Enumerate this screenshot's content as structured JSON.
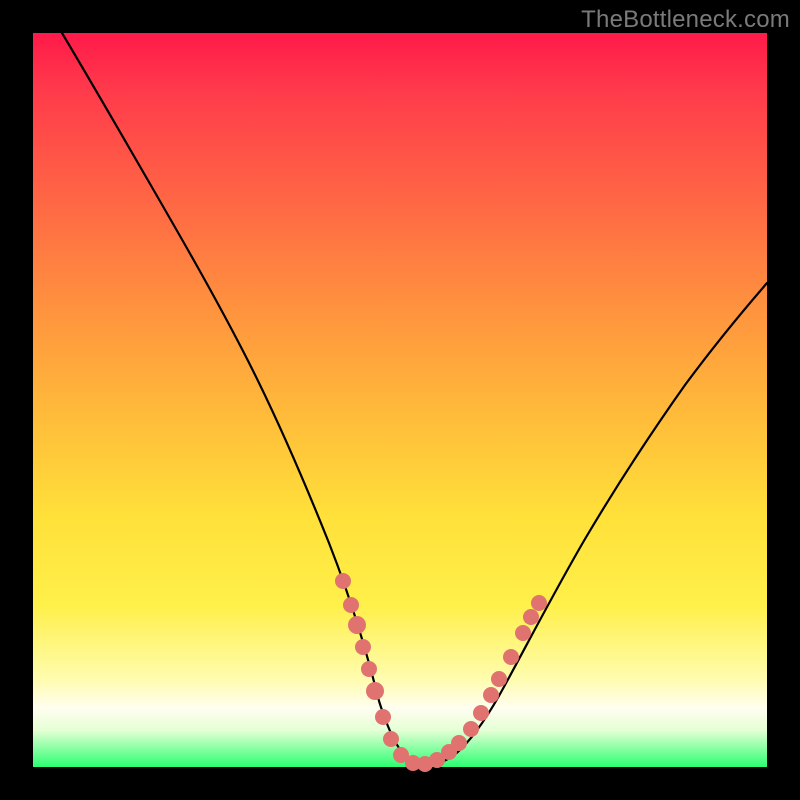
{
  "watermark": "TheBottleneck.com",
  "colors": {
    "frame_bg": "#000000",
    "curve_stroke": "#000000",
    "dot_fill": "#e0736f",
    "gradient_stops": [
      "#ff1a4a",
      "#ff3b4b",
      "#ff6a44",
      "#ff943e",
      "#ffbb3a",
      "#ffe13a",
      "#fff04a",
      "#fffcae",
      "#fffef0",
      "#e5ffd4",
      "#2bff71"
    ]
  },
  "chart_data": {
    "type": "line",
    "title": "",
    "xlabel": "",
    "ylabel": "",
    "x_range": [
      0,
      100
    ],
    "y_range": [
      0,
      100
    ],
    "series": [
      {
        "name": "bottleneck-curve",
        "x": [
          4,
          8,
          12,
          16,
          20,
          24,
          28,
          32,
          36,
          40,
          44,
          46,
          48,
          50,
          52,
          54,
          56,
          60,
          64,
          68,
          72,
          76,
          80,
          84,
          88,
          92,
          96,
          100
        ],
        "y": [
          100,
          93,
          86,
          79,
          72,
          64,
          56,
          47,
          38,
          28,
          17,
          11,
          6,
          2,
          0,
          0,
          1,
          3,
          8,
          14,
          21,
          29,
          37,
          44,
          51,
          57,
          62,
          66
        ]
      },
      {
        "name": "marker-dots",
        "x": [
          42,
          43,
          44,
          45,
          46,
          47,
          49,
          50,
          51,
          52,
          53,
          54,
          55,
          57,
          59,
          60,
          61,
          62,
          63,
          64
        ],
        "y": [
          22,
          18,
          16,
          13,
          11,
          8,
          2,
          1,
          0,
          0,
          0,
          0,
          1,
          2,
          4,
          6,
          8,
          10,
          12,
          14
        ]
      }
    ],
    "note": "Chart has no axes, ticks, or labels; values are read off relative position within the 734×734 plot area and normalized to 0–100."
  }
}
